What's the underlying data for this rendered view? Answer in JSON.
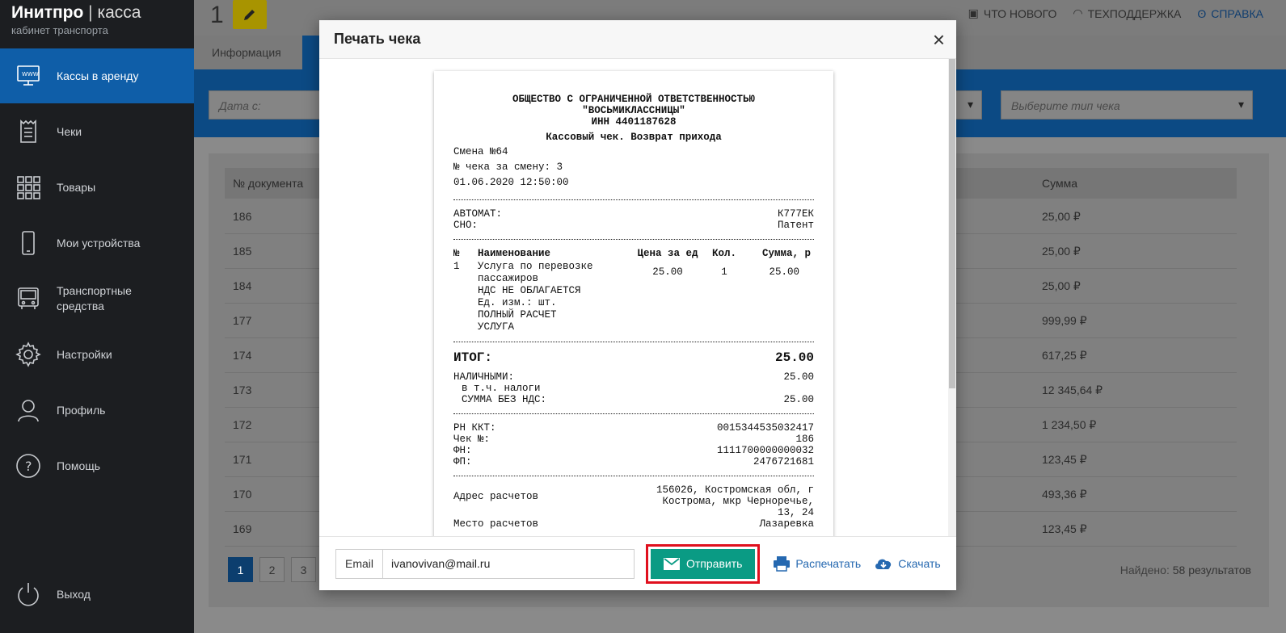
{
  "brand": {
    "name": "Инитпро",
    "separator": "|",
    "product": "касса",
    "subtitle": "кабинет транспорта"
  },
  "sidebar": {
    "items": [
      {
        "label": "Кассы в аренду",
        "icon": "www-monitor-icon",
        "active": true
      },
      {
        "label": "Чеки",
        "icon": "receipt-icon"
      },
      {
        "label": "Товары",
        "icon": "grid-icon"
      },
      {
        "label": "Мои устройства",
        "icon": "phone-icon"
      },
      {
        "label": "Транспортные средства",
        "icon": "bus-icon"
      },
      {
        "label": "Настройки",
        "icon": "gear-icon"
      },
      {
        "label": "Профиль",
        "icon": "user-icon"
      },
      {
        "label": "Помощь",
        "icon": "help-icon"
      },
      {
        "label": "Выход",
        "icon": "power-icon"
      }
    ]
  },
  "header": {
    "number": "1",
    "links": [
      {
        "label": "ЧТО НОВОГО",
        "icon": "news-icon"
      },
      {
        "label": "ТЕХПОДДЕРЖКА",
        "icon": "headset-icon"
      },
      {
        "label": "СПРАВКА",
        "icon": "owl-icon"
      }
    ]
  },
  "tabs": [
    {
      "label": "Информация"
    }
  ],
  "filters": {
    "date_from_placeholder": "Дата с:",
    "check_type_placeholder": "Выберите тип чека"
  },
  "table": {
    "headers": [
      "№ документа",
      "Сумма"
    ],
    "rows": [
      {
        "doc": "186",
        "sum": "25,00 ₽"
      },
      {
        "doc": "185",
        "sum": "25,00 ₽"
      },
      {
        "doc": "184",
        "sum": "25,00 ₽"
      },
      {
        "doc": "177",
        "sum": "999,99 ₽"
      },
      {
        "doc": "174",
        "sum": "617,25 ₽"
      },
      {
        "doc": "173",
        "sum": "12 345,64 ₽"
      },
      {
        "doc": "172",
        "sum": "1 234,50 ₽"
      },
      {
        "doc": "171",
        "sum": "123,45 ₽"
      },
      {
        "doc": "170",
        "sum": "493,36 ₽"
      },
      {
        "doc": "169",
        "sum": "123,45 ₽"
      }
    ]
  },
  "pagination": {
    "pages": [
      "1",
      "2",
      "3"
    ],
    "found_label": "Найдено:",
    "found_value": "58 результатов"
  },
  "modal": {
    "title": "Печать чека",
    "close": "×",
    "receipt": {
      "org_line1": "ОБЩЕСТВО С ОГРАНИЧЕННОЙ ОТВЕТСТВЕННОСТЬЮ",
      "org_line2": "\"ВОСЬМИКЛАССНИЦЫ\"",
      "inn": "ИНН 4401187628",
      "check_title": "Кассовый чек. Возврат прихода",
      "shift": "Смена №64",
      "check_in_shift": "№ чека за смену: 3",
      "datetime": "01.06.2020 12:50:00",
      "automat_label": "АВТОМАТ:",
      "automat_value": "К777ЕК",
      "sno_label": "СНО:",
      "sno_value": "Патент",
      "items_header": [
        "№",
        "Наименование",
        "Цена за ед",
        "Кол.",
        "Сумма, р"
      ],
      "item": {
        "num": "1",
        "name_lines": [
          "Услуга по перевозке",
          "пассажиров",
          "НДС НЕ ОБЛАГАЕТСЯ",
          "Ед. изм.: шт.",
          "ПОЛНЫЙ РАСЧЕТ",
          "УСЛУГА"
        ],
        "price": "25.00",
        "qty": "1",
        "sum": "25.00"
      },
      "total_label": "ИТОГ:",
      "total_value": "25.00",
      "cash_label": "НАЛИЧНЫМИ:",
      "cash_value": "25.00",
      "taxes_label": "в т.ч. налоги",
      "no_vat_label": "СУММА БЕЗ НДС:",
      "no_vat_value": "25.00",
      "rn_label": "РН ККТ:",
      "rn_value": "0015344535032417",
      "check_no_label": "Чек №:",
      "check_no_value": "186",
      "fn_label": "ФН:",
      "fn_value": "1111700000000032",
      "fp_label": "ФП:",
      "fp_value": "2476721681",
      "address_label": "Адрес расчетов",
      "address_lines": [
        "156026, Костромская обл, г",
        "Кострома, мкр Черноречье,",
        "13, 24"
      ],
      "place_label": "Место расчетов",
      "place_value": "Лазаревка"
    },
    "footer": {
      "email_label": "Email",
      "email_value": "ivanovivan@mail.ru",
      "send_label": "Отправить",
      "print_label": "Распечатать",
      "download_label": "Скачать"
    },
    "colors": {
      "send": "#0a9b84",
      "highlight": "#e0101e",
      "link": "#2568b0"
    }
  }
}
